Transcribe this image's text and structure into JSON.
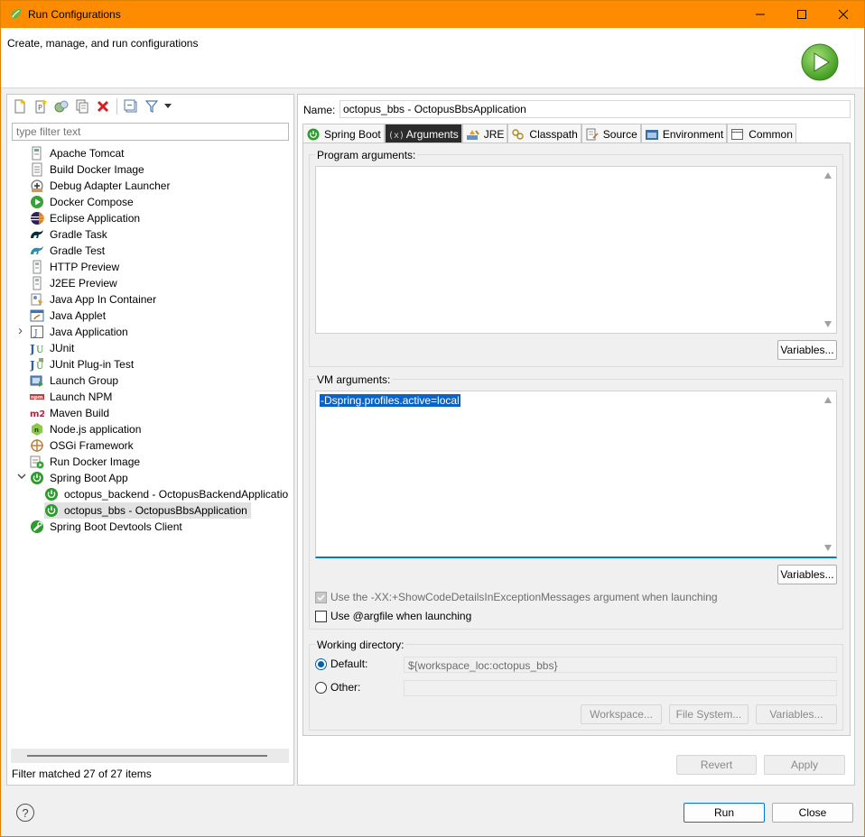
{
  "window": {
    "title": "Run Configurations"
  },
  "banner": {
    "description": "Create, manage, and run configurations"
  },
  "left": {
    "filter_placeholder": "type filter text",
    "tree": [
      {
        "label": "Apache Tomcat",
        "icon": "tomcat-icon"
      },
      {
        "label": "Build Docker Image",
        "icon": "docker-build-icon"
      },
      {
        "label": "Debug Adapter Launcher",
        "icon": "debug-adapter-icon"
      },
      {
        "label": "Docker Compose",
        "icon": "docker-compose-icon"
      },
      {
        "label": "Eclipse Application",
        "icon": "eclipse-icon"
      },
      {
        "label": "Gradle Task",
        "icon": "gradle-icon"
      },
      {
        "label": "Gradle Test",
        "icon": "gradle-test-icon"
      },
      {
        "label": "HTTP Preview",
        "icon": "http-preview-icon"
      },
      {
        "label": "J2EE Preview",
        "icon": "j2ee-preview-icon"
      },
      {
        "label": "Java App In Container",
        "icon": "java-container-icon"
      },
      {
        "label": "Java Applet",
        "icon": "java-applet-icon"
      },
      {
        "label": "Java Application",
        "icon": "java-application-icon"
      },
      {
        "label": "JUnit",
        "icon": "junit-icon"
      },
      {
        "label": "JUnit Plug-in Test",
        "icon": "junit-plugin-icon"
      },
      {
        "label": "Launch Group",
        "icon": "launch-group-icon"
      },
      {
        "label": "Launch NPM",
        "icon": "npm-icon"
      },
      {
        "label": "Maven Build",
        "icon": "maven-icon"
      },
      {
        "label": "Node.js application",
        "icon": "nodejs-icon"
      },
      {
        "label": "OSGi Framework",
        "icon": "osgi-icon"
      },
      {
        "label": "Run Docker Image",
        "icon": "docker-run-icon"
      },
      {
        "label": "Spring Boot App",
        "icon": "spring-boot-icon"
      },
      {
        "label": "octopus_backend - OctopusBackendApplicatio",
        "icon": "spring-boot-icon"
      },
      {
        "label": "octopus_bbs - OctopusBbsApplication",
        "icon": "spring-boot-icon"
      },
      {
        "label": "Spring Boot Devtools Client",
        "icon": "spring-devtools-icon"
      }
    ],
    "matched": "Filter matched 27 of 27 items"
  },
  "right": {
    "name_label": "Name:",
    "name_value": "octopus_bbs - OctopusBbsApplication",
    "tabs": [
      {
        "label": "Spring Boot",
        "icon": "spring-boot-icon"
      },
      {
        "label": "Arguments",
        "icon": "arguments-icon"
      },
      {
        "label": "JRE",
        "icon": "jre-icon"
      },
      {
        "label": "Classpath",
        "icon": "classpath-icon"
      },
      {
        "label": "Source",
        "icon": "source-icon"
      },
      {
        "label": "Environment",
        "icon": "environment-icon"
      },
      {
        "label": "Common",
        "icon": "common-icon"
      }
    ],
    "program_args_label": "Program arguments:",
    "program_args_value": "",
    "variables_label": "Variables...",
    "vm_args_label": "VM arguments:",
    "vm_args_value": "-Dspring.profiles.active=local",
    "show_code_details_label": "Use the -XX:+ShowCodeDetailsInExceptionMessages argument when launching",
    "argfile_label": "Use @argfile when launching",
    "working_dir_label": "Working directory:",
    "default_label": "Default:",
    "default_value": "${workspace_loc:octopus_bbs}",
    "other_label": "Other:",
    "workspace_btn": "Workspace...",
    "filesystem_btn": "File System...",
    "wd_variables_btn": "Variables...",
    "revert_btn": "Revert",
    "apply_btn": "Apply"
  },
  "footer": {
    "run_btn": "Run",
    "close_btn": "Close"
  },
  "colors": {
    "titlebar": "#ff8c00",
    "accent": "#0078d7",
    "spring": "#2e9b2e"
  }
}
